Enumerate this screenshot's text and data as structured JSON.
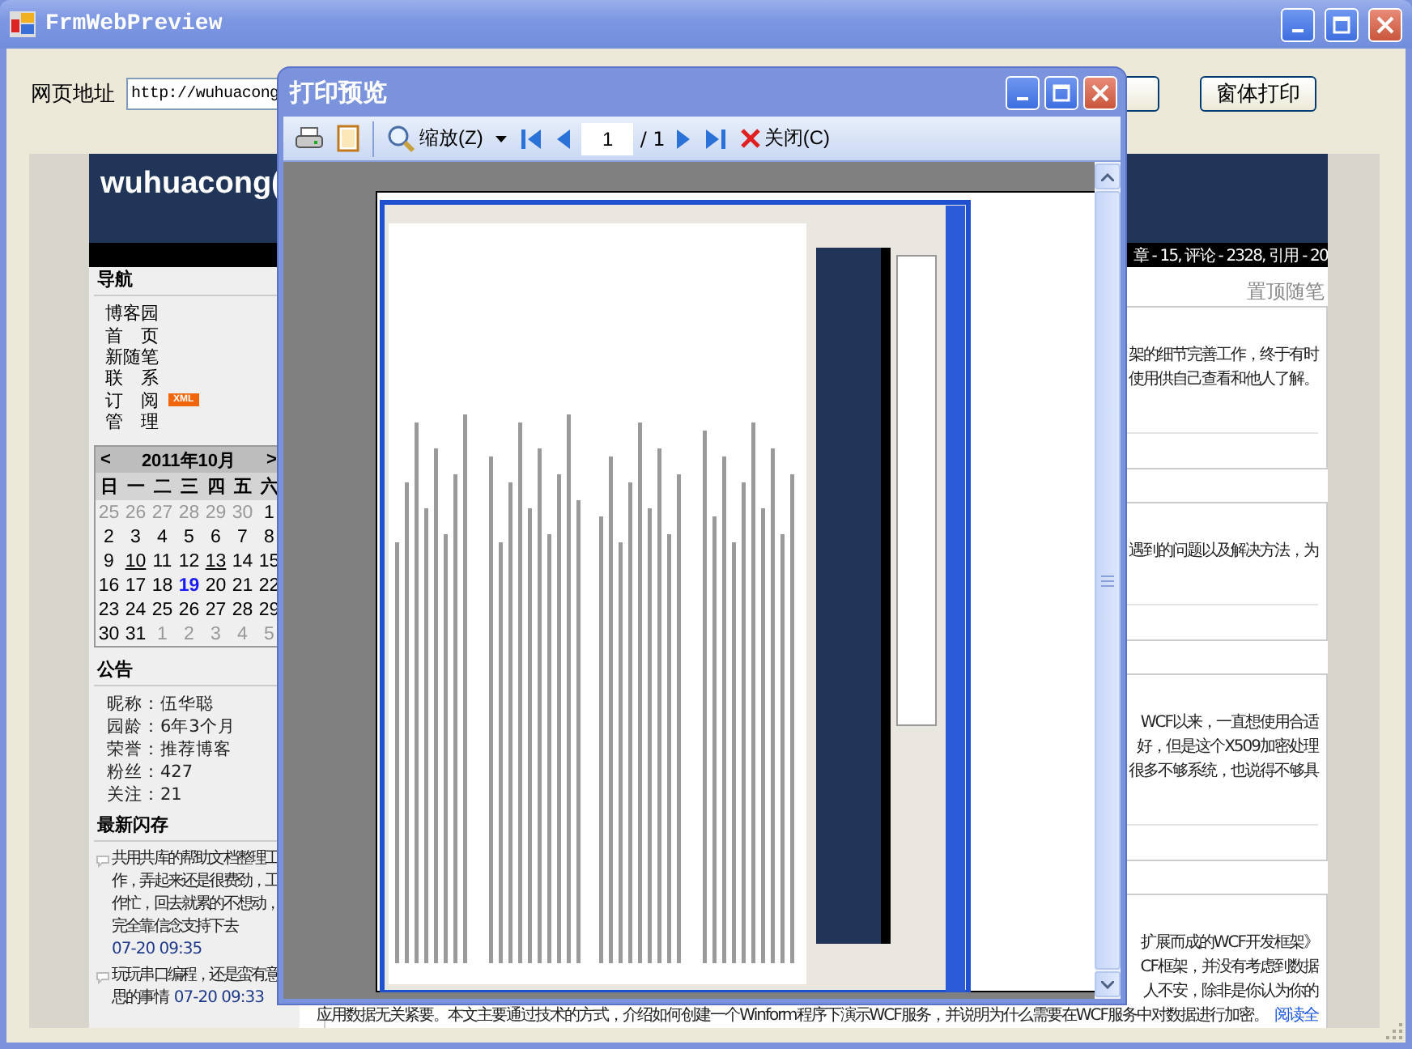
{
  "window": {
    "title": "FrmWebPreview"
  },
  "address_bar": {
    "label": "网页地址",
    "value": "http://wuhuacong"
  },
  "buttons": [
    "窗体打印"
  ],
  "web_page": {
    "blog_title": "wuhuacong(",
    "stats": "章 - 15, 评论 - 2328, 引用 - 20",
    "sidebar": {
      "nav_heading": "导航",
      "nav_items": [
        {
          "label": "博客园"
        },
        {
          "label": "首　页"
        },
        {
          "label": "新随笔"
        },
        {
          "label": "联　系"
        },
        {
          "label": "订　阅",
          "badge": "XML"
        },
        {
          "label": "管　理"
        }
      ],
      "calendar": {
        "prev": "<",
        "title": "2011年10月",
        "next": ">",
        "weekdays": [
          "日",
          "一",
          "二",
          "三",
          "四",
          "五",
          "六"
        ],
        "weeks": [
          [
            {
              "day": "25",
              "kind": "other"
            },
            {
              "day": "26",
              "kind": "other"
            },
            {
              "day": "27",
              "kind": "other"
            },
            {
              "day": "28",
              "kind": "other"
            },
            {
              "day": "29",
              "kind": "other"
            },
            {
              "day": "30",
              "kind": "other"
            },
            {
              "day": "1",
              "kind": "normal"
            }
          ],
          [
            {
              "day": "2",
              "kind": "normal"
            },
            {
              "day": "3",
              "kind": "normal"
            },
            {
              "day": "4",
              "kind": "normal"
            },
            {
              "day": "5",
              "kind": "normal"
            },
            {
              "day": "6",
              "kind": "normal"
            },
            {
              "day": "7",
              "kind": "normal"
            },
            {
              "day": "8",
              "kind": "normal"
            }
          ],
          [
            {
              "day": "9",
              "kind": "normal"
            },
            {
              "day": "10",
              "kind": "link"
            },
            {
              "day": "11",
              "kind": "normal"
            },
            {
              "day": "12",
              "kind": "normal"
            },
            {
              "day": "13",
              "kind": "link"
            },
            {
              "day": "14",
              "kind": "normal"
            },
            {
              "day": "15",
              "kind": "normal"
            }
          ],
          [
            {
              "day": "16",
              "kind": "normal"
            },
            {
              "day": "17",
              "kind": "normal"
            },
            {
              "day": "18",
              "kind": "normal"
            },
            {
              "day": "19",
              "kind": "today"
            },
            {
              "day": "20",
              "kind": "normal"
            },
            {
              "day": "21",
              "kind": "normal"
            },
            {
              "day": "22",
              "kind": "normal"
            }
          ],
          [
            {
              "day": "23",
              "kind": "normal"
            },
            {
              "day": "24",
              "kind": "normal"
            },
            {
              "day": "25",
              "kind": "normal"
            },
            {
              "day": "26",
              "kind": "normal"
            },
            {
              "day": "27",
              "kind": "normal"
            },
            {
              "day": "28",
              "kind": "normal"
            },
            {
              "day": "29",
              "kind": "normal"
            }
          ],
          [
            {
              "day": "30",
              "kind": "normal"
            },
            {
              "day": "31",
              "kind": "normal"
            },
            {
              "day": "1",
              "kind": "other"
            },
            {
              "day": "2",
              "kind": "other"
            },
            {
              "day": "3",
              "kind": "other"
            },
            {
              "day": "4",
              "kind": "other"
            },
            {
              "day": "5",
              "kind": "other"
            }
          ]
        ]
      },
      "notice_heading": "公告",
      "notice_lines": [
        "昵称：伍华聪",
        "园龄：6年3个月",
        "荣誉：推荐博客",
        "粉丝：427",
        "关注：21"
      ],
      "flash_heading": "最新闪存",
      "flash_items": [
        {
          "lines": [
            "共用共库的帮助文档整理工",
            "作，弄起来还是很费劲，工",
            "作忙，回去就累的不想动，",
            "完全靠信念支持下去"
          ],
          "time": "07-20 09:35"
        },
        {
          "lines": [
            "玩玩串口编程，还是蛮有意",
            "思的事情"
          ],
          "time": "07-20 09:33"
        }
      ]
    },
    "main": {
      "pinned_heading": "置顶随笔",
      "posts": [
        {
          "lines": [
            "架的细节完善工作，终于有时",
            "使用供自己查看和他人了解。"
          ]
        },
        {
          "lines": [
            "遇到的问题以及解决方法，为"
          ]
        },
        {
          "lines": [
            "WCF以来，一直想使用合适",
            "好，但是这个X509加密处理",
            "很多不够系统，也说得不够具"
          ]
        },
        {
          "lines": [
            "扩展而成的WCF开发框架》",
            "CF框架，并没有考虑到数据",
            "人不安，除非是你认为你的"
          ],
          "full_line": "应用数据无关紧要。本文主要通过技术的方式，介绍如何创建一个Winform程序下演示WCF服务，并说明为什么需要在WCF服务中对数据进行加密。",
          "link": "阅读全"
        }
      ]
    }
  },
  "print_preview": {
    "title": "打印预览",
    "zoom_label": "缩放(Z)",
    "page": "1",
    "page_total": "/ 1",
    "close_label": "关闭(C)"
  }
}
